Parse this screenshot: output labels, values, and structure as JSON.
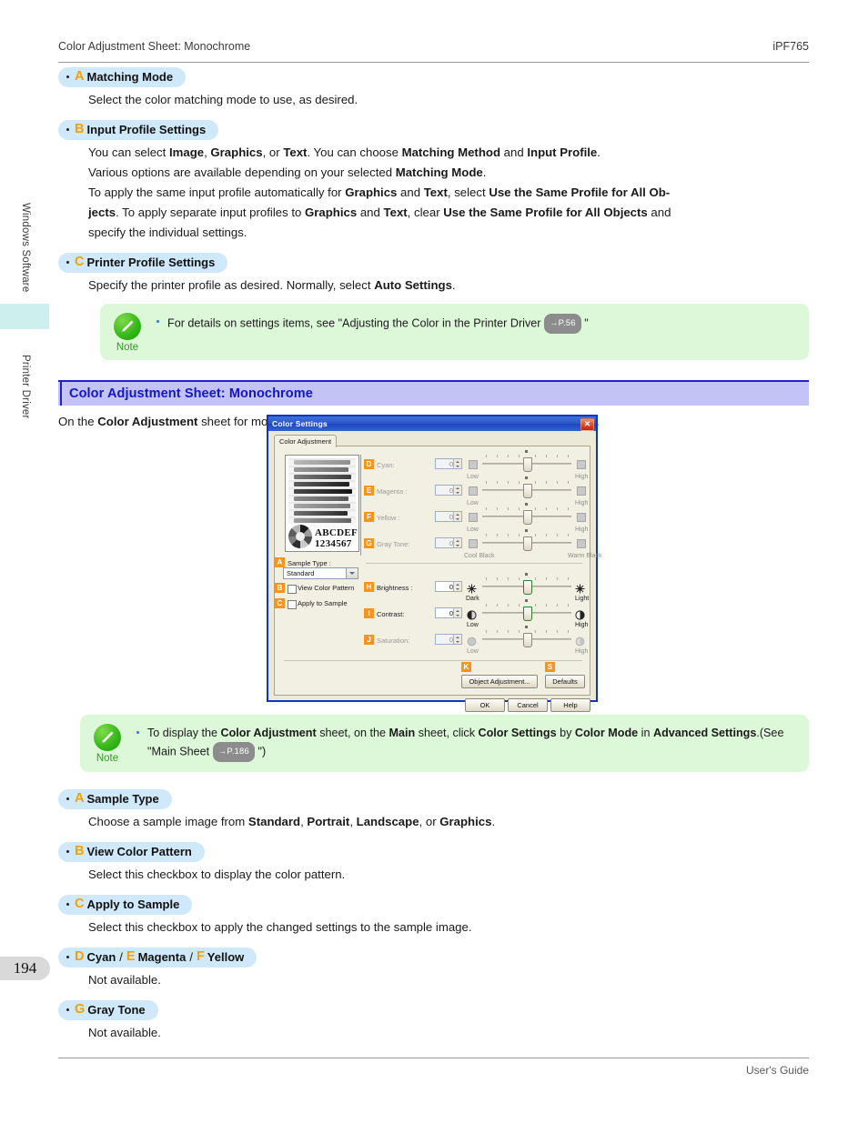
{
  "header": {
    "left": "Color Adjustment Sheet: Monochrome",
    "right": "iPF765"
  },
  "footer": {
    "right": "User's Guide"
  },
  "sidebar": {
    "label_top": "Windows Software",
    "label_bottom": "Printer Driver",
    "page_number": "194",
    "tab_color": "#cdf0ef"
  },
  "top_items": [
    {
      "marker": "A",
      "title": "Matching Mode",
      "body": "Select the color matching mode to use, as desired."
    },
    {
      "marker": "B",
      "title": "Input Profile Settings",
      "line1_a": "You can select ",
      "line1_b1": "Image",
      "line1_c": ", ",
      "line1_b2": "Graphics",
      "line1_d": ", or ",
      "line1_b3": "Text",
      "line1_e": ". You can choose ",
      "line1_b4": "Matching Method",
      "line1_f": " and ",
      "line1_b5": "Input Profile",
      "line1_g": ".",
      "line2_a": "Various options are available depending on your selected ",
      "line2_b": "Matching Mode",
      "line2_c": ".",
      "line3_a": "To apply the same input profile automatically for ",
      "line3_b1": "Graphics",
      "line3_c": " and ",
      "line3_b2": "Text",
      "line3_d": ", select ",
      "line3_b3": "Use the Same Profile for All Ob-",
      "line4_b1": "jects",
      "line4_a": ". To apply separate input profiles to ",
      "line4_b2": "Graphics",
      "line4_c": " and ",
      "line4_b3": "Text",
      "line4_d": ", clear ",
      "line4_b4": "Use the Same Profile for All Objects",
      "line4_e": " and",
      "line5": "specify the individual settings."
    },
    {
      "marker": "C",
      "title": "Printer Profile Settings",
      "body_a": "Specify the printer profile as desired. Normally, select ",
      "body_b": "Auto Settings",
      "body_c": "."
    }
  ],
  "note_top": {
    "label": "Note",
    "text_a": "For details on settings items, see \"Adjusting the Color in the Printer Driver ",
    "pageref": "→P.56",
    "text_b": " \""
  },
  "section": {
    "title": "Color Adjustment Sheet: Monochrome",
    "intro_a": "On the ",
    "intro_b": "Color Adjustment",
    "intro_c": " sheet for monochrome printing, you can adjust the brightness and contrast."
  },
  "dialog": {
    "title": "Color Settings",
    "close": "✕",
    "tab": "Color Adjustment",
    "preview": {
      "abc": "ABCDEF",
      "num": "1234567"
    },
    "sample_type_label": "Sample Type :",
    "sample_type_value": "Standard",
    "checkboxes": [
      {
        "marker": "B",
        "label": "View Color Pattern",
        "checked": false
      },
      {
        "marker": "C",
        "label": "Apply to Sample",
        "checked": false
      }
    ],
    "color_rows": [
      {
        "marker": "D",
        "label": "Cyan:",
        "value": "0",
        "low": "Low",
        "high": "High",
        "enabled": false
      },
      {
        "marker": "E",
        "label": "Magenta :",
        "value": "0",
        "low": "Low",
        "high": "High",
        "enabled": false
      },
      {
        "marker": "F",
        "label": "Yellow :",
        "value": "0",
        "low": "Low",
        "high": "High",
        "enabled": false
      },
      {
        "marker": "G",
        "label": "Gray Tone:",
        "value": "0",
        "low": "Cool Black",
        "high": "Warm Black",
        "enabled": false
      }
    ],
    "adjust_rows": [
      {
        "marker": "H",
        "label": "Brightness :",
        "value": "0",
        "low": "Dark",
        "high": "Light",
        "enabled": true,
        "icon_left": "sun-dim-icon",
        "icon_right": "sun-bright-icon"
      },
      {
        "marker": "I",
        "label": "Contrast:",
        "value": "0",
        "low": "Low",
        "high": "High",
        "enabled": true,
        "icon_left": "contrast-low-icon",
        "icon_right": "contrast-high-icon"
      },
      {
        "marker": "J",
        "label": "Saturation:",
        "value": "0",
        "low": "Low",
        "high": "High",
        "enabled": false,
        "icon_left": "saturation-low-icon",
        "icon_right": "saturation-high-icon"
      }
    ],
    "buttons": [
      {
        "marker": "K",
        "label": "Object Adjustment..."
      },
      {
        "marker": "S",
        "label": "Defaults"
      }
    ],
    "footer_buttons": [
      {
        "label": "OK"
      },
      {
        "label": "Cancel"
      },
      {
        "label": "Help"
      }
    ]
  },
  "note_bottom": {
    "label": "Note",
    "t1": "To display the ",
    "b1": "Color Adjustment",
    "t2": " sheet, on the ",
    "b2": "Main",
    "t3": " sheet, click ",
    "b3": "Color Settings",
    "t4": " by ",
    "b4": "Color Mode",
    "t5": " in ",
    "b5": "Advanced Settings",
    "t6": ".(See",
    "t7": "\"Main Sheet ",
    "pageref": "→P.186",
    "t8": " \")"
  },
  "bottom_items": [
    {
      "marker": "A",
      "title": "Sample Type",
      "body_a": "Choose a sample image from ",
      "body_b1": "Standard",
      "body_c": ", ",
      "body_b2": "Portrait",
      "body_d": ", ",
      "body_b3": "Landscape",
      "body_e": ", or ",
      "body_b4": "Graphics",
      "body_f": "."
    },
    {
      "marker": "B",
      "title": "View Color Pattern",
      "body": "Select this checkbox to display the color pattern."
    },
    {
      "marker": "C",
      "title": "Apply to Sample",
      "body": "Select this checkbox to apply the changed settings to the sample image."
    },
    {
      "marker": "D",
      "title": "Cyan",
      "marker2": "E",
      "title2": "Magenta",
      "marker3": "F",
      "title3": "Yellow",
      "body": "Not available."
    },
    {
      "marker": "G",
      "title": "Gray Tone",
      "body": "Not available."
    }
  ],
  "colors": {
    "chip_bg": "#cfe9fa",
    "marker_orange": "#f5a000",
    "section_bar": "#c3c3f5",
    "section_text": "#1414c8",
    "note_bg": "#ddf8d8",
    "dialog_border": "#0a36c0"
  }
}
